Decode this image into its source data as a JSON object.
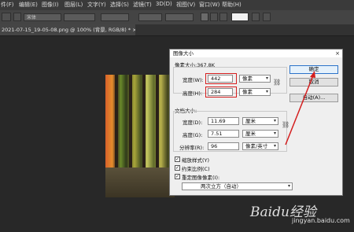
{
  "menu": [
    "件(F)",
    "编辑(E)",
    "图像(I)",
    "图层(L)",
    "文字(Y)",
    "选择(S)",
    "滤镜(T)",
    "3D(D)",
    "视图(V)",
    "窗口(W)",
    "帮助(H)"
  ],
  "options_bar": {
    "font": "宋体"
  },
  "document_tab": "2021-07-15_19-05-08.png @ 100% (背景, RGB/8) * ×",
  "dialog": {
    "title": "图像大小",
    "close": "×",
    "pixel_size_label": "像素大小:367.8K",
    "pixel": {
      "width_label": "宽度(W):",
      "width_value": "442",
      "width_unit": "像素",
      "height_label": "高度(H):",
      "height_value": "284",
      "height_unit": "像素"
    },
    "doc_size_label": "文档大小:",
    "doc": {
      "width_label": "宽度(D):",
      "width_value": "11.69",
      "width_unit": "厘米",
      "height_label": "高度(G):",
      "height_value": "7.51",
      "height_unit": "厘米",
      "res_label": "分辨率(R):",
      "res_value": "96",
      "res_unit": "像素/英寸"
    },
    "buttons": {
      "ok": "确定",
      "cancel": "取消",
      "auto": "自动(A)..."
    },
    "checkboxes": [
      {
        "label": "缩放样式(Y)",
        "checked": true
      },
      {
        "label": "约束比例(C)",
        "checked": true
      },
      {
        "label": "重定图像像素(I):",
        "checked": true
      }
    ],
    "resample": "两次立方（自动）"
  },
  "watermark": {
    "brand": "Baidu经验",
    "url": "jingyan.baidu.com"
  },
  "colors": {
    "annotation_red": "#d41e1e",
    "ok_border": "#2b73c9"
  }
}
